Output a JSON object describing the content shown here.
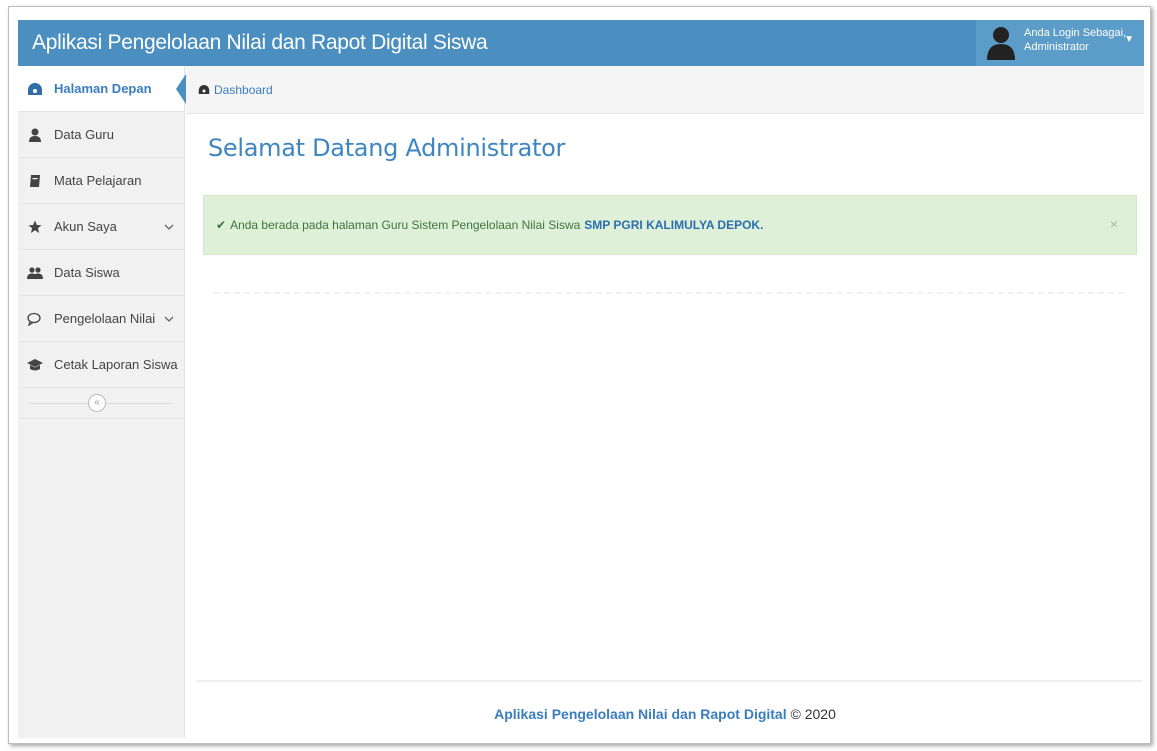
{
  "header": {
    "app_title": "Aplikasi Pengelolaan Nilai dan Rapot Digital Siswa",
    "user_line1": "Anda Login Sebagai,",
    "user_line2": "Administrator"
  },
  "sidebar": {
    "items": [
      {
        "label": "Halaman Depan",
        "icon": "dashboard-icon",
        "active": true
      },
      {
        "label": "Data Guru",
        "icon": "user-icon"
      },
      {
        "label": "Mata Pelajaran",
        "icon": "book-icon"
      },
      {
        "label": "Akun Saya",
        "icon": "star-icon",
        "has_submenu": true
      },
      {
        "label": "Data Siswa",
        "icon": "users-icon"
      },
      {
        "label": "Pengelolaan Nilai",
        "icon": "comments-icon",
        "has_submenu": true
      },
      {
        "label": "Cetak Laporan Siswa",
        "icon": "graduation-cap-icon"
      }
    ],
    "collapse_glyph": "«"
  },
  "breadcrumb": {
    "label": "Dashboard"
  },
  "main": {
    "title": "Selamat Datang Administrator",
    "alert_text": "Anda berada pada halaman Guru Sistem Pengelolaan Nilai Siswa",
    "alert_school": "SMP PGRI KALIMULYA DEPOK.",
    "alert_close": "×"
  },
  "footer": {
    "brand": "Aplikasi Pengelolaan Nilai dan Rapot Digital",
    "copyright": "© 2020"
  },
  "colors": {
    "header": "#4a8fc0",
    "accent": "#3a7dbf",
    "alert_bg": "#dff0d8"
  }
}
